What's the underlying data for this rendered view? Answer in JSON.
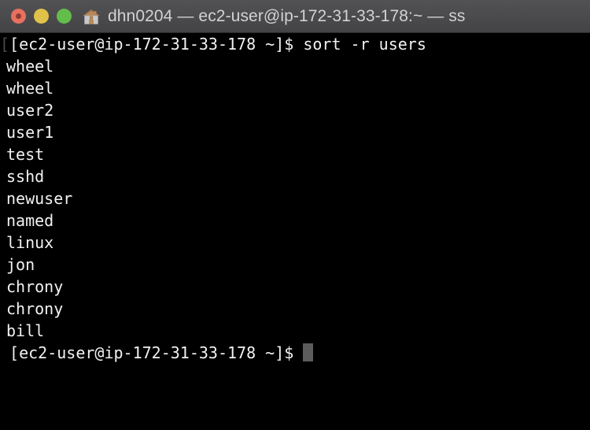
{
  "window": {
    "title": "dhn0204 — ec2-user@ip-172-31-33-178:~ — ss",
    "home_icon": "house-icon",
    "controls": {
      "close_label": "",
      "minimize_label": "",
      "maximize_label": ""
    },
    "colors": {
      "titlebar_bg": "#4b4b4d",
      "title_text": "#d2d2d2",
      "terminal_bg": "#000000",
      "terminal_text": "#f2f2f2",
      "cursor": "#5c5c5c",
      "close_button": "#e8705f",
      "minimize_button": "#e0c14a",
      "maximize_button": "#63bd4a"
    }
  },
  "terminal": {
    "clipped_glyph": "[",
    "prompt": "[ec2-user@ip-172-31-33-178 ~]$ ",
    "command": "sort -r users",
    "output": [
      "wheel",
      "wheel",
      "user2",
      "user1",
      "test",
      "sshd",
      "newuser",
      "named",
      "linux",
      "jon",
      "chrony",
      "chrony",
      "bill"
    ],
    "final_prompt": "[ec2-user@ip-172-31-33-178 ~]$ ",
    "cursor_visible": true
  }
}
